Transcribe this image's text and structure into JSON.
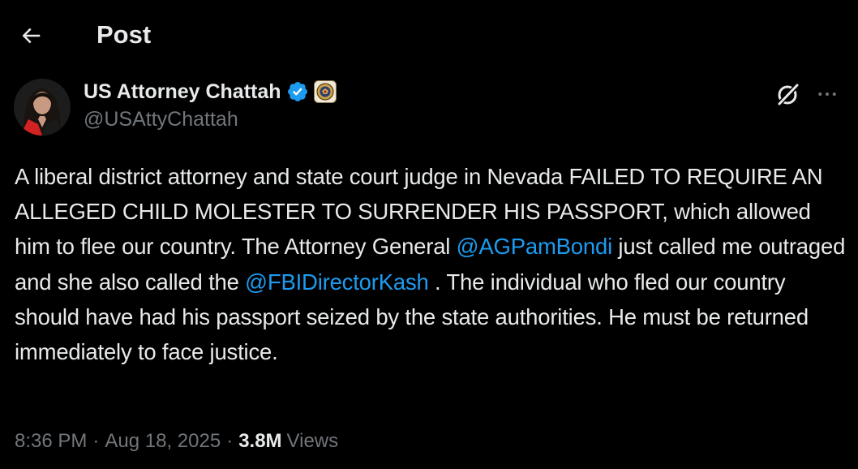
{
  "header": {
    "title": "Post",
    "back_icon": "arrow-left-icon"
  },
  "author": {
    "name": "US Attorney Chattah",
    "handle": "@USAttyChattah",
    "verified": true,
    "verified_color": "#1d9bf0",
    "affiliate_badge_icon": "doj-seal-icon"
  },
  "actions": {
    "grok_icon": "grok-icon",
    "more_icon": "more-horizontal-icon"
  },
  "tweet": {
    "text_part1": "A liberal district attorney and state court judge in Nevada FAILED TO REQUIRE AN ALLEGED CHILD MOLESTER TO SURRENDER HIS PASSPORT, which allowed him to flee our country. The Attorney General ",
    "mention1": "@AGPamBondi",
    "text_part2": " just called me outraged and she also called the ",
    "mention2": "@FBIDirectorKash",
    "text_part3": " . The individual who fled our country should have had his passport seized by the state authorities. He must be returned immediately to face justice."
  },
  "meta": {
    "time": "8:36 PM",
    "sep1": "·",
    "date": "Aug 18, 2025",
    "sep2": "·",
    "views_count": "3.8M",
    "views_label": "Views"
  },
  "colors": {
    "background": "#000000",
    "text": "#e7e9ea",
    "secondary": "#71767b",
    "link": "#1d9bf0"
  }
}
